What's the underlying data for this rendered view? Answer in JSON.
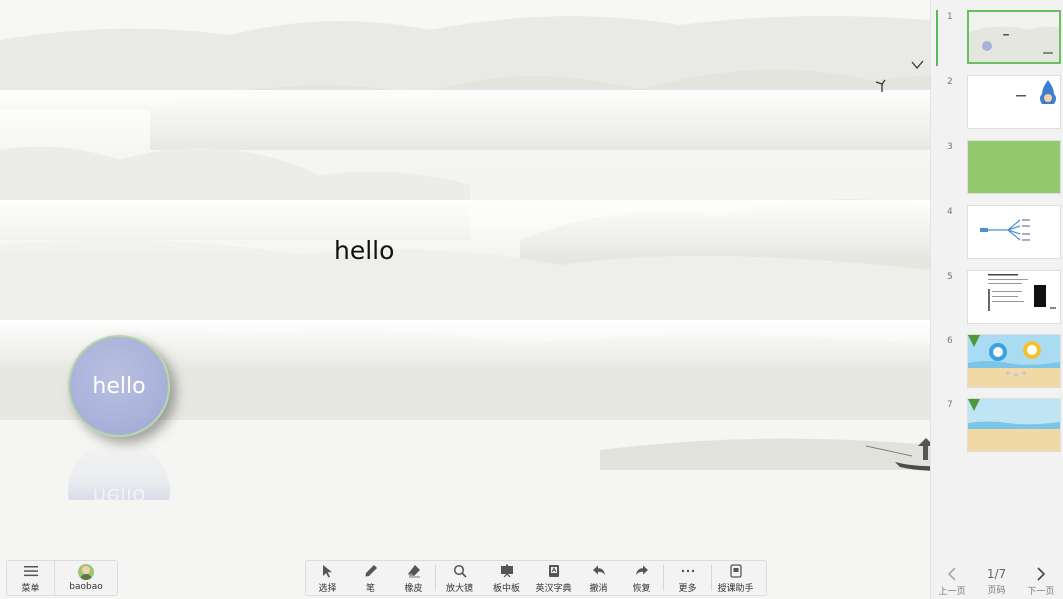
{
  "canvas": {
    "title_text": "hello",
    "bubble_text": "hello",
    "bubble_reflection_text": "hello"
  },
  "toolbar_left": {
    "menu_label": "菜单",
    "menu_icon": "hamburger-icon",
    "user_name": "baobao",
    "user_icon": "avatar-icon"
  },
  "toolbar": {
    "items": [
      {
        "label": "选择",
        "icon": "cursor-icon"
      },
      {
        "label": "笔",
        "icon": "pen-icon"
      },
      {
        "label": "橡皮",
        "icon": "eraser-icon"
      },
      {
        "label": "放大镜",
        "icon": "magnifier-icon"
      },
      {
        "label": "板中板",
        "icon": "board-icon"
      },
      {
        "label": "英汉字典",
        "icon": "dictionary-icon"
      },
      {
        "label": "撤消",
        "icon": "undo-icon"
      },
      {
        "label": "恢复",
        "icon": "redo-icon"
      },
      {
        "label": "更多",
        "icon": "more-icon"
      },
      {
        "label": "授课助手",
        "icon": "assistant-icon"
      }
    ]
  },
  "slides": {
    "current": 1,
    "items": [
      {
        "num": "1",
        "kind": "landscape"
      },
      {
        "num": "2",
        "kind": "figure"
      },
      {
        "num": "3",
        "kind": "green"
      },
      {
        "num": "4",
        "kind": "mindmap"
      },
      {
        "num": "5",
        "kind": "document"
      },
      {
        "num": "6",
        "kind": "beach-cartoon"
      },
      {
        "num": "7",
        "kind": "beach"
      }
    ]
  },
  "pager": {
    "prev_label": "上一页",
    "page_label": "页码",
    "next_label": "下一页",
    "page_value": "1/7"
  },
  "colors": {
    "accent_green": "#6abf5e",
    "bubble": "#aab2da",
    "slide3_green": "#93c86f"
  }
}
